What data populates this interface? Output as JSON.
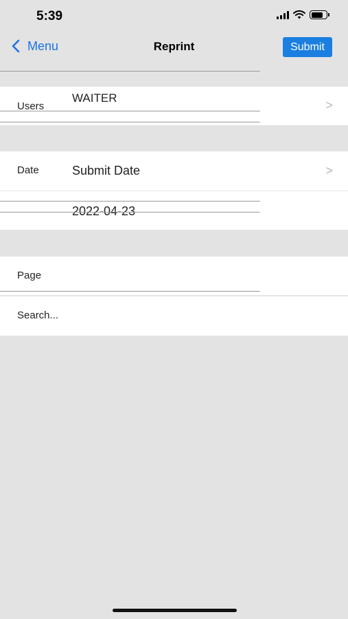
{
  "status": {
    "time": "5:39",
    "icons": [
      "signal-icon",
      "wifi-icon",
      "battery-icon"
    ]
  },
  "nav": {
    "back_label": "Menu",
    "title": "Reprint",
    "submit_label": "Submit"
  },
  "form": {
    "users": {
      "label": "Users",
      "value": "WAITER"
    },
    "date": {
      "label": "Date",
      "value": "Submit Date",
      "date_value": "2022-04-23"
    },
    "page": {
      "label": "Page"
    },
    "search": {
      "placeholder": "Search..."
    }
  },
  "colors": {
    "accent": "#1a7fe0",
    "background": "#e3e3e3"
  }
}
